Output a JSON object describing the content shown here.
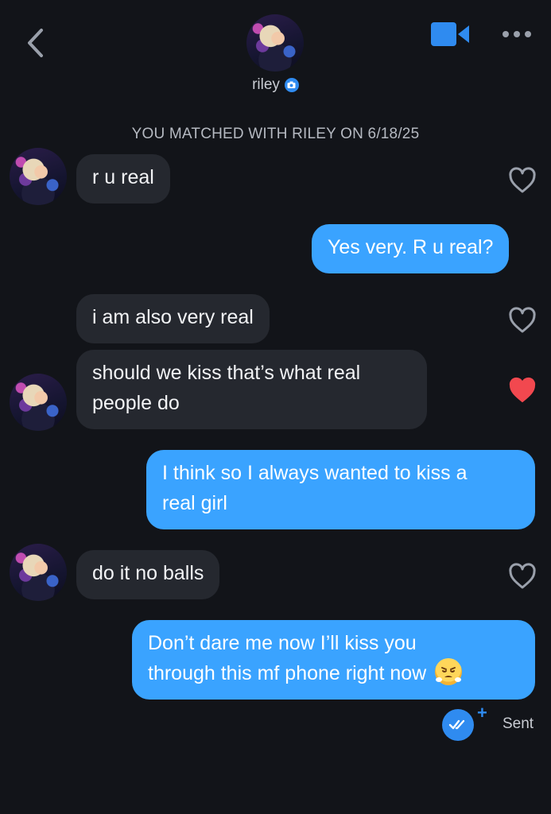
{
  "header": {
    "name": "riley",
    "verified_icon": "camera-verified-icon",
    "back_icon": "chevron-left-icon",
    "video_icon": "video-camera-icon",
    "more_icon": "more-dots-icon"
  },
  "matched_text": "YOU MATCHED WITH RILEY ON 6/18/25",
  "messages": [
    {
      "from": "riley",
      "text": "r u real",
      "liked": false
    },
    {
      "from": "me",
      "text": "Yes very. R u real?"
    },
    {
      "from": "riley",
      "text": "i am also very real",
      "liked": false
    },
    {
      "from": "riley",
      "text_line1": "should we kiss that’s what real",
      "text_line2": "people do",
      "liked": true
    },
    {
      "from": "me",
      "text_line1": "I think so I always wanted to kiss a",
      "text_line2": "real girl"
    },
    {
      "from": "riley",
      "text": "do it no balls",
      "liked": false
    },
    {
      "from": "me",
      "text_line1": "Don’t dare me now I’ll kiss you",
      "text_line2": "through this mf phone right now",
      "emoji": "huffing-face-emoji"
    }
  ],
  "status": {
    "label": "Sent",
    "plus": "+",
    "icon": "double-check-icon"
  },
  "colors": {
    "background": "#121419",
    "received_bubble": "#25282f",
    "sent_bubble": "#3aa3ff",
    "accent": "#2f8bf0",
    "heart_liked": "#f2484f"
  }
}
